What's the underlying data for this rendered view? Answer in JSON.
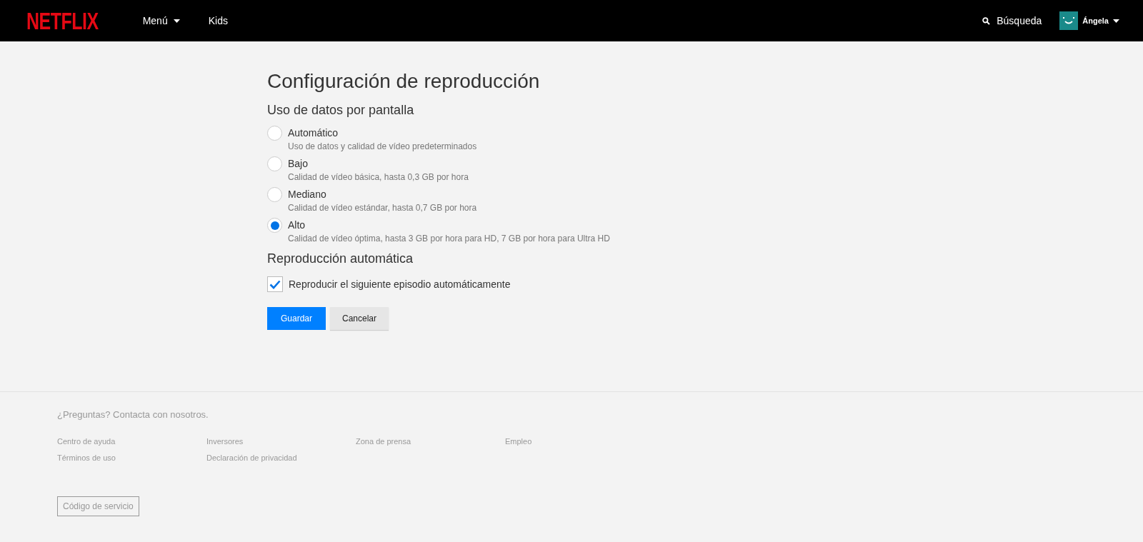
{
  "header": {
    "logo": "NETFLIX",
    "nav": [
      {
        "label": "Menú",
        "dropdown": true
      },
      {
        "label": "Kids",
        "dropdown": false
      }
    ],
    "search": "Búsqueda",
    "profile": "Ángela"
  },
  "page": {
    "title": "Configuración de reproducción",
    "data_section": "Uso de datos por pantalla",
    "options": [
      {
        "label": "Automático",
        "description": "Uso de datos y calidad de vídeo predeterminados",
        "selected": false
      },
      {
        "label": "Bajo",
        "description": "Calidad de vídeo básica, hasta 0,3 GB por hora",
        "selected": false
      },
      {
        "label": "Mediano",
        "description": "Calidad de vídeo estándar, hasta 0,7 GB por hora",
        "selected": false
      },
      {
        "label": "Alto",
        "description": "Calidad de vídeo óptima, hasta 3 GB por hora para HD, 7 GB por hora para Ultra HD",
        "selected": true
      }
    ],
    "autoplay_section": "Reproducción automática",
    "autoplay": {
      "label": "Reproducir el siguiente episodio automáticamente",
      "checked": true
    },
    "buttons": [
      "Guardar",
      "Cancelar"
    ]
  },
  "footer": {
    "contact": "¿Preguntas? Contacta con nosotros.",
    "links": [
      "Centro de ayuda",
      "Inversores",
      "Zona de prensa",
      "Empleo",
      "Términos de uso",
      "Declaración de privacidad"
    ],
    "service_code": "Código de servicio"
  }
}
